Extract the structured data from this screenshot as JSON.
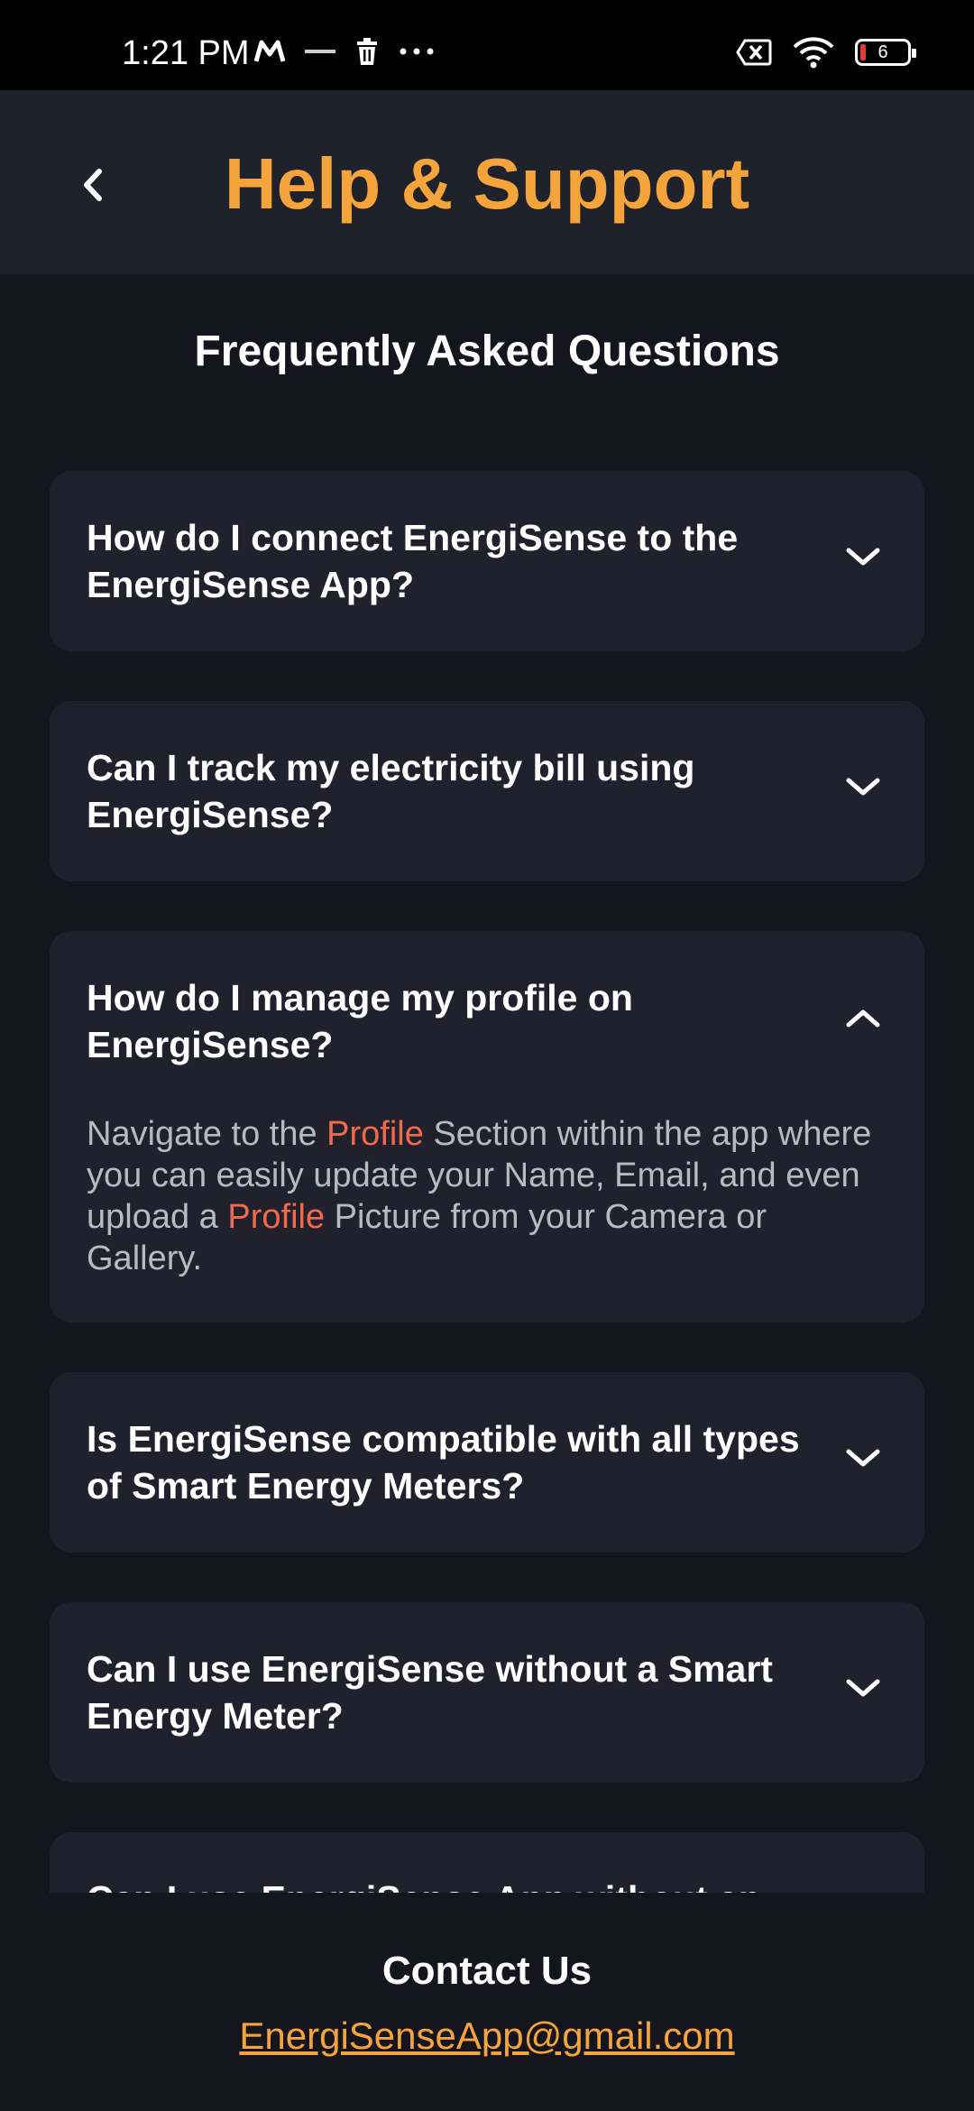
{
  "status_bar": {
    "time": "1:21 PM",
    "battery_level": "6",
    "icons": [
      "m-app-icon",
      "energy-app-icon",
      "trash-icon",
      "more-dots-icon",
      "no-sim-icon",
      "wifi-icon",
      "battery-icon"
    ]
  },
  "header": {
    "title": "Help & Support",
    "back_icon": "chevron-left-icon"
  },
  "faq": {
    "section_title": "Frequently Asked Questions",
    "items": [
      {
        "question": "How do I connect EnergiSense to the EnergiSense App?",
        "expanded": false
      },
      {
        "question": "Can I track my electricity bill using EnergiSense?",
        "expanded": false
      },
      {
        "question": "How do I manage my profile on EnergiSense?",
        "expanded": true,
        "answer": {
          "part1": "Navigate to the ",
          "highlight1": "Profile",
          "part2": " Section within the app where you can easily update your Name, Email, and even upload a ",
          "highlight2": "Profile",
          "part3": " Picture from your Camera or Gallery."
        }
      },
      {
        "question": "Is EnergiSense compatible with all types of Smart Energy Meters?",
        "expanded": false
      },
      {
        "question": "Can I use EnergiSense without a Smart Energy Meter?",
        "expanded": false
      },
      {
        "question": "Can I use EnergiSense App without an",
        "expanded": false
      }
    ]
  },
  "contact": {
    "title": "Contact Us",
    "email": "EnergiSenseApp@gmail.com"
  },
  "colors": {
    "accent": "#f5a43b",
    "highlight": "#f26a4b",
    "background": "#15161d",
    "card": "#20212c",
    "header": "#1f212b"
  }
}
